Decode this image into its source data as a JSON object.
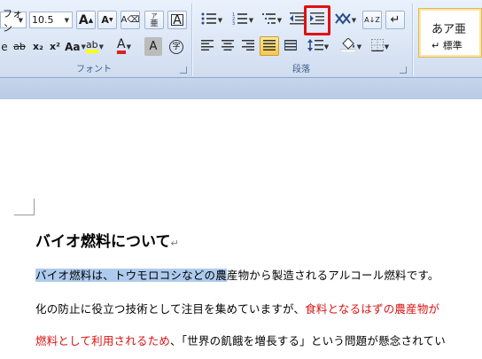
{
  "ribbon": {
    "font_group": {
      "font_name_value": "フォン",
      "font_size_value": "10.5",
      "grow_label": "A",
      "shrink_label": "A",
      "phonetic_label": "亜",
      "phonetic_top": "ア",
      "char_border_label": "A",
      "strike_label": "ab",
      "subscript_label": "x₂",
      "superscript_label": "x²",
      "case_label": "Aa",
      "highlight_label": "ab",
      "color_label": "A",
      "shade_label": "A",
      "enclose_label": "字",
      "group_label": "フォント",
      "prefix_glyph": "e"
    },
    "paragraph_group": {
      "group_label": "段落",
      "sort_label": "A↓Z"
    },
    "styles": {
      "preview": "あア亜",
      "name": "↵ 標準"
    }
  },
  "document": {
    "heading": "バイオ燃料について",
    "heading_mark": "↵",
    "line1_selected": "バイオ燃料は、トウモロコシなどの農",
    "line1_rest": "産物から製造されるアルコール燃料です。",
    "line2_black": "化の防止に役立つ技術として注目を集めていますが、",
    "line2_red": "食料となるはずの農産物が",
    "line3_red": "燃料として利用されるため",
    "line3_black": "、「世界の飢餓を増長する」という問題が懸念されてい",
    "colors": {
      "selection": "#aecbef",
      "red_text": "#d81212",
      "callout": "#e21010"
    }
  }
}
